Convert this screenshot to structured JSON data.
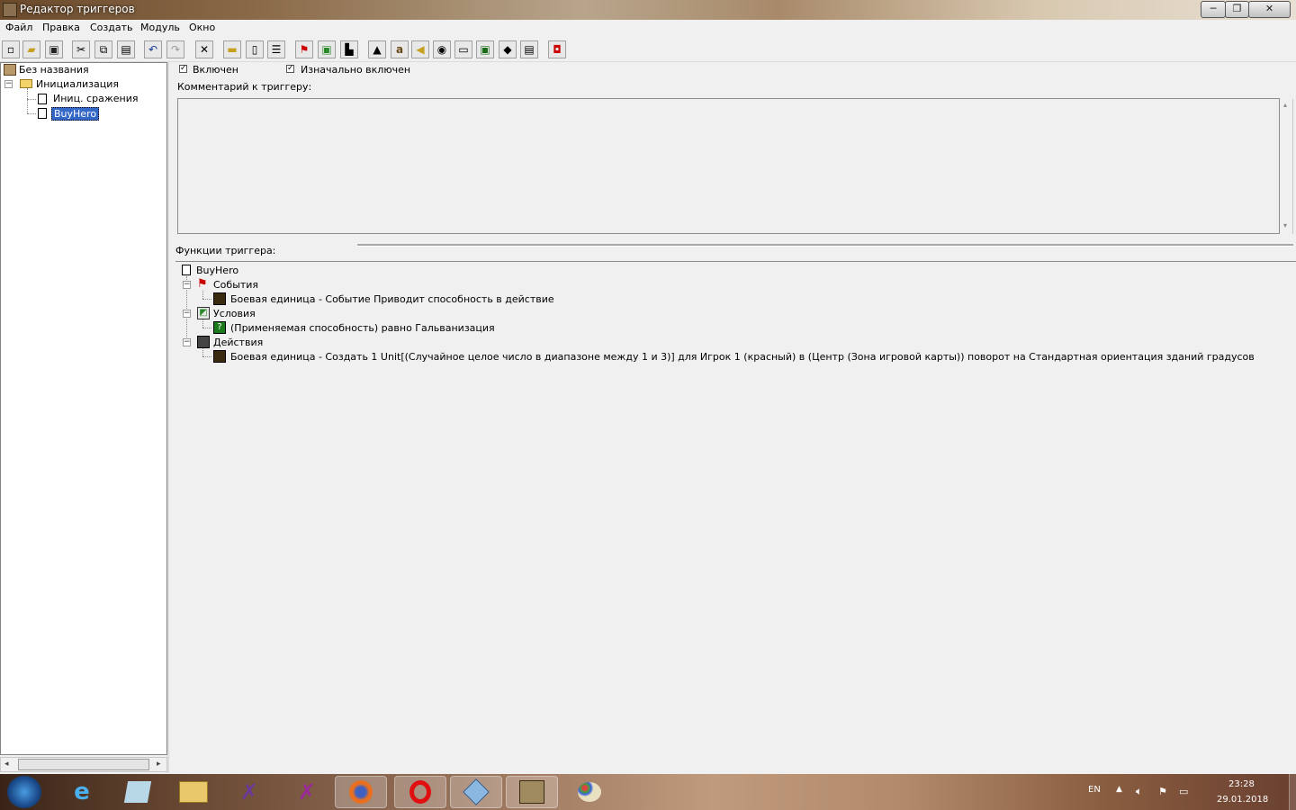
{
  "window": {
    "title": "Редактор триггеров",
    "min": "─",
    "max": "❐",
    "close": "✕"
  },
  "menu": [
    "Файл",
    "Правка",
    "Создать",
    "Модуль",
    "Окно"
  ],
  "tree": {
    "root": "Без названия",
    "category": "Инициализация",
    "items": [
      "Иниц. сражения",
      "BuyHero"
    ]
  },
  "trigger": {
    "enabled_label": "Включен",
    "initially_on_label": "Изначально включен",
    "comment_label": "Комментарий к триггеру:",
    "functions_label": "Функции триггера:",
    "name": "BuyHero",
    "events_label": "События",
    "event": "Боевая единица - Событие Приводит способность в действие",
    "conditions_label": "Условия",
    "condition": "(Применяемая способность) равно Гальванизация",
    "actions_label": "Действия",
    "action": "Боевая единица - Создать 1 Unit[(Случайное целое число в диапазоне между 1 и 3)] для Игрок 1 (красный) в (Центр (Зона игровой карты)) поворот на Стандартная ориентация зданий градусов"
  },
  "taskbar": {
    "lang": "EN",
    "time": "23:28",
    "date": "29.01.2018"
  }
}
